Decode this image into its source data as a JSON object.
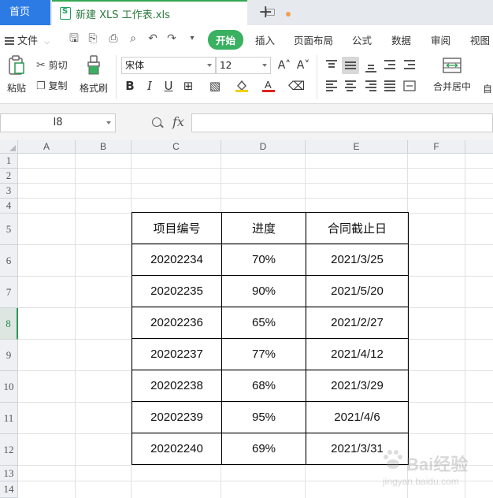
{
  "tabs": {
    "home_label": "首页",
    "doc_title": "新建 XLS 工作表.xls"
  },
  "menu": {
    "file_label": "文件",
    "tabs": [
      "开始",
      "插入",
      "页面布局",
      "公式",
      "数据",
      "审阅",
      "视图"
    ],
    "active_tab": "开始"
  },
  "ribbon": {
    "paste_label": "粘贴",
    "cut_label": "剪切",
    "copy_label": "复制",
    "format_painter_label": "格式刷",
    "font_name": "宋体",
    "font_size": "12",
    "merge_label": "合并居中",
    "wrap_label": "自"
  },
  "formula_bar": {
    "name_box": "I8",
    "fx_label": "fx",
    "content": ""
  },
  "sheet": {
    "columns": [
      "A",
      "B",
      "C",
      "D",
      "E",
      "F"
    ],
    "rows": [
      "1",
      "2",
      "3",
      "4",
      "5",
      "6",
      "7",
      "8",
      "9",
      "10",
      "11",
      "12",
      "13",
      "14"
    ],
    "selected_row": "8",
    "selected_cell": "I8"
  },
  "table": {
    "headers": [
      "项目编号",
      "进度",
      "合同截止日"
    ],
    "rows": [
      [
        "20202234",
        "70%",
        "2021/3/25"
      ],
      [
        "20202235",
        "90%",
        "2021/5/20"
      ],
      [
        "20202236",
        "65%",
        "2021/2/27"
      ],
      [
        "20202237",
        "77%",
        "2021/4/12"
      ],
      [
        "20202238",
        "68%",
        "2021/3/29"
      ],
      [
        "20202239",
        "95%",
        "2021/4/6"
      ],
      [
        "20202240",
        "69%",
        "2021/3/31"
      ]
    ]
  },
  "watermark": {
    "text": "Bai经验",
    "sub": "jingyan.baidu.com"
  },
  "colors": {
    "home_tab": "#2c7be5",
    "active_tab": "#3ab061",
    "selected_row_header": "#2a9a52"
  }
}
